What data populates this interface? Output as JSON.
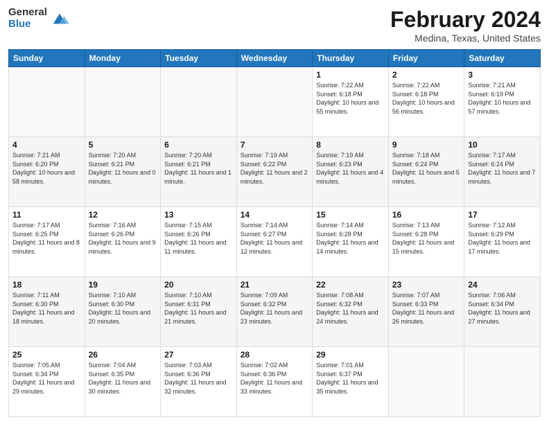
{
  "logo": {
    "general": "General",
    "blue": "Blue"
  },
  "header": {
    "title": "February 2024",
    "subtitle": "Medina, Texas, United States"
  },
  "days_of_week": [
    "Sunday",
    "Monday",
    "Tuesday",
    "Wednesday",
    "Thursday",
    "Friday",
    "Saturday"
  ],
  "weeks": [
    [
      {
        "day": "",
        "info": ""
      },
      {
        "day": "",
        "info": ""
      },
      {
        "day": "",
        "info": ""
      },
      {
        "day": "",
        "info": ""
      },
      {
        "day": "1",
        "info": "Sunrise: 7:22 AM\nSunset: 6:18 PM\nDaylight: 10 hours and 55 minutes."
      },
      {
        "day": "2",
        "info": "Sunrise: 7:22 AM\nSunset: 6:18 PM\nDaylight: 10 hours and 56 minutes."
      },
      {
        "day": "3",
        "info": "Sunrise: 7:21 AM\nSunset: 6:19 PM\nDaylight: 10 hours and 57 minutes."
      }
    ],
    [
      {
        "day": "4",
        "info": "Sunrise: 7:21 AM\nSunset: 6:20 PM\nDaylight: 10 hours and 58 minutes."
      },
      {
        "day": "5",
        "info": "Sunrise: 7:20 AM\nSunset: 6:21 PM\nDaylight: 11 hours and 0 minutes."
      },
      {
        "day": "6",
        "info": "Sunrise: 7:20 AM\nSunset: 6:21 PM\nDaylight: 11 hours and 1 minute."
      },
      {
        "day": "7",
        "info": "Sunrise: 7:19 AM\nSunset: 6:22 PM\nDaylight: 11 hours and 2 minutes."
      },
      {
        "day": "8",
        "info": "Sunrise: 7:19 AM\nSunset: 6:23 PM\nDaylight: 11 hours and 4 minutes."
      },
      {
        "day": "9",
        "info": "Sunrise: 7:18 AM\nSunset: 6:24 PM\nDaylight: 11 hours and 5 minutes."
      },
      {
        "day": "10",
        "info": "Sunrise: 7:17 AM\nSunset: 6:24 PM\nDaylight: 11 hours and 7 minutes."
      }
    ],
    [
      {
        "day": "11",
        "info": "Sunrise: 7:17 AM\nSunset: 6:25 PM\nDaylight: 11 hours and 8 minutes."
      },
      {
        "day": "12",
        "info": "Sunrise: 7:16 AM\nSunset: 6:26 PM\nDaylight: 11 hours and 9 minutes."
      },
      {
        "day": "13",
        "info": "Sunrise: 7:15 AM\nSunset: 6:26 PM\nDaylight: 11 hours and 11 minutes."
      },
      {
        "day": "14",
        "info": "Sunrise: 7:14 AM\nSunset: 6:27 PM\nDaylight: 11 hours and 12 minutes."
      },
      {
        "day": "15",
        "info": "Sunrise: 7:14 AM\nSunset: 6:28 PM\nDaylight: 11 hours and 14 minutes."
      },
      {
        "day": "16",
        "info": "Sunrise: 7:13 AM\nSunset: 6:28 PM\nDaylight: 11 hours and 15 minutes."
      },
      {
        "day": "17",
        "info": "Sunrise: 7:12 AM\nSunset: 6:29 PM\nDaylight: 11 hours and 17 minutes."
      }
    ],
    [
      {
        "day": "18",
        "info": "Sunrise: 7:11 AM\nSunset: 6:30 PM\nDaylight: 11 hours and 18 minutes."
      },
      {
        "day": "19",
        "info": "Sunrise: 7:10 AM\nSunset: 6:30 PM\nDaylight: 11 hours and 20 minutes."
      },
      {
        "day": "20",
        "info": "Sunrise: 7:10 AM\nSunset: 6:31 PM\nDaylight: 11 hours and 21 minutes."
      },
      {
        "day": "21",
        "info": "Sunrise: 7:09 AM\nSunset: 6:32 PM\nDaylight: 11 hours and 23 minutes."
      },
      {
        "day": "22",
        "info": "Sunrise: 7:08 AM\nSunset: 6:32 PM\nDaylight: 11 hours and 24 minutes."
      },
      {
        "day": "23",
        "info": "Sunrise: 7:07 AM\nSunset: 6:33 PM\nDaylight: 11 hours and 26 minutes."
      },
      {
        "day": "24",
        "info": "Sunrise: 7:06 AM\nSunset: 6:34 PM\nDaylight: 11 hours and 27 minutes."
      }
    ],
    [
      {
        "day": "25",
        "info": "Sunrise: 7:05 AM\nSunset: 6:34 PM\nDaylight: 11 hours and 29 minutes."
      },
      {
        "day": "26",
        "info": "Sunrise: 7:04 AM\nSunset: 6:35 PM\nDaylight: 11 hours and 30 minutes."
      },
      {
        "day": "27",
        "info": "Sunrise: 7:03 AM\nSunset: 6:36 PM\nDaylight: 11 hours and 32 minutes."
      },
      {
        "day": "28",
        "info": "Sunrise: 7:02 AM\nSunset: 6:36 PM\nDaylight: 11 hours and 33 minutes."
      },
      {
        "day": "29",
        "info": "Sunrise: 7:01 AM\nSunset: 6:37 PM\nDaylight: 11 hours and 35 minutes."
      },
      {
        "day": "",
        "info": ""
      },
      {
        "day": "",
        "info": ""
      }
    ]
  ]
}
